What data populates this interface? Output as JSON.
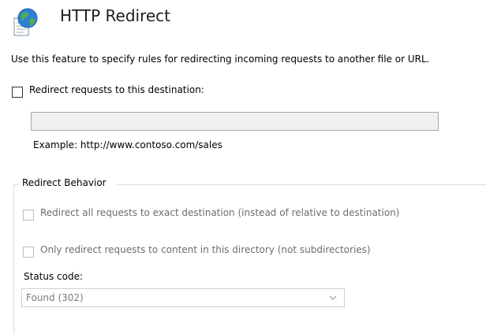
{
  "header": {
    "title": "HTTP Redirect",
    "icon": "globe-page-icon"
  },
  "description": "Use this feature to specify rules for redirecting incoming requests to another file or URL.",
  "redirect": {
    "checkbox_label": "Redirect requests to this destination:",
    "checked": false,
    "destination_value": "",
    "example_text": "Example: http://www.contoso.com/sales"
  },
  "behavior": {
    "group_title": "Redirect Behavior",
    "exact_destination_label": "Redirect all requests to exact destination (instead of relative to destination)",
    "exact_destination_checked": false,
    "directory_only_label": "Only redirect requests to content in this directory (not subdirectories)",
    "directory_only_checked": false,
    "status_code_label": "Status code:",
    "status_code_value": "Found (302)"
  },
  "colors": {
    "disabled_text": "#6d6d6d",
    "input_disabled_bg": "#f0f0f0",
    "group_border": "#dcdcdc"
  }
}
